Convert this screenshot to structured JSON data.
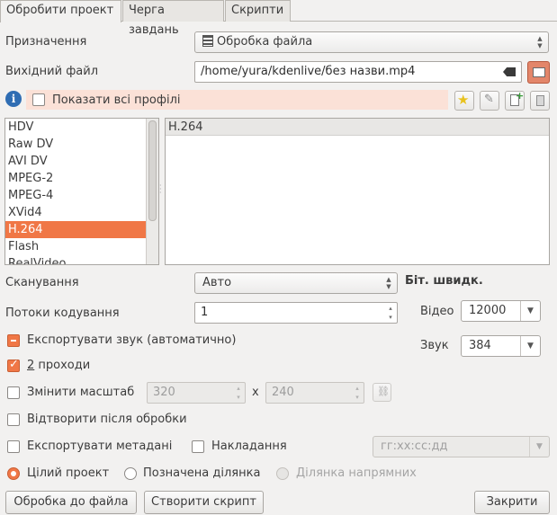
{
  "tabs": [
    {
      "label": "Обробити проект",
      "active": true
    },
    {
      "label": "Черга завдань",
      "active": false
    },
    {
      "label": "Скрипти",
      "active": false
    }
  ],
  "destination": {
    "label": "Призначення",
    "value": "Обробка файла",
    "icon": "film-icon"
  },
  "output_file": {
    "label": "Вихідний файл",
    "value": "/home/yura/kdenlive/без назви.mp4"
  },
  "show_all_profiles": {
    "label": "Показати всі профілі",
    "checked": false
  },
  "formats": [
    "HDV",
    "Raw DV",
    "AVI DV",
    "MPEG-2",
    "MPEG-4",
    "XVid4",
    "H.264",
    "Flash",
    "RealVideo"
  ],
  "selected_format_index": 6,
  "profiles": [
    "H.264"
  ],
  "scanning": {
    "label": "Сканування",
    "value": "Авто"
  },
  "threads": {
    "label": "Потоки кодування",
    "value": "1"
  },
  "bitrate": {
    "title": "Біт. швидк.",
    "video_label": "Відео",
    "video_value": "12000",
    "audio_label": "Звук",
    "audio_value": "384"
  },
  "export_audio": {
    "label": "Експортувати звук (автоматично)"
  },
  "two_pass": {
    "label_prefix": "2",
    "label_rest": " проходи",
    "checked": true
  },
  "rescale": {
    "label": "Змінити масштаб",
    "width": "320",
    "x": "x",
    "height": "240",
    "checked": false
  },
  "play_after": {
    "label": "Відтворити після обробки",
    "checked": false
  },
  "export_metadata": {
    "label": "Експортувати метадані",
    "checked": false
  },
  "overlay": {
    "label": "Накладання",
    "checked": false,
    "timecode_placeholder": "гг:хх:сс:дд"
  },
  "range": {
    "whole": "Цілий проект",
    "selected": "Позначена ділянка",
    "guides": "Ділянка напрямних"
  },
  "buttons": {
    "render": "Обробка до файла",
    "script": "Створити скрипт",
    "close": "Закрити"
  },
  "colors": {
    "accent": "#f07746",
    "info_bar": "#fbe1d7"
  }
}
